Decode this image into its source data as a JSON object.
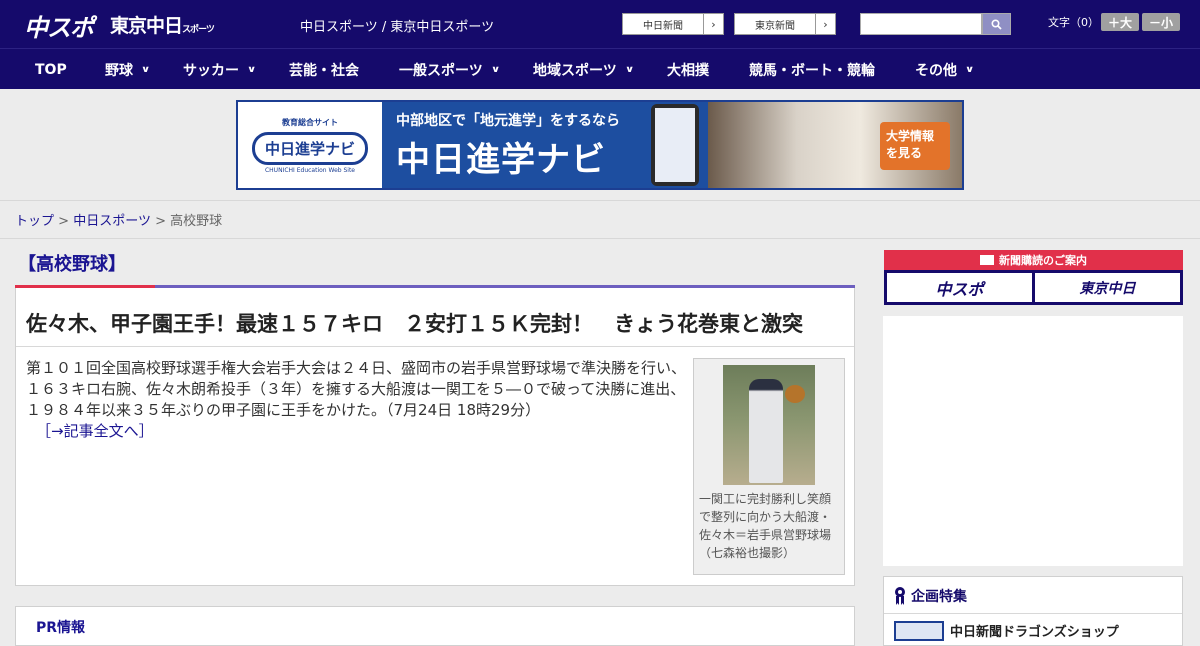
{
  "header": {
    "logo_chusupo": "中スポ",
    "logo_tokyo": "東京中日",
    "logo_tokyo_small": "スポーツ",
    "tagline": "中日スポーツ / 東京中日スポーツ",
    "paper_links": [
      {
        "label": "中日新聞"
      },
      {
        "label": "東京新聞"
      }
    ],
    "search_placeholder": "",
    "font_size_label": "文字（0）",
    "font_bigger": "＋大",
    "font_smaller": "－小"
  },
  "nav": {
    "items": [
      {
        "label": "TOP",
        "has_menu": false
      },
      {
        "label": "野球",
        "has_menu": true
      },
      {
        "label": "サッカー",
        "has_menu": true
      },
      {
        "label": "芸能・社会",
        "has_menu": false
      },
      {
        "label": "一般スポーツ",
        "has_menu": true
      },
      {
        "label": "地域スポーツ",
        "has_menu": true
      },
      {
        "label": "大相撲",
        "has_menu": false
      },
      {
        "label": "競馬・ボート・競輪",
        "has_menu": false
      },
      {
        "label": "その他",
        "has_menu": true
      }
    ]
  },
  "banner": {
    "logo_small": "教育総合サイト",
    "logo_big": "中日進学ナビ",
    "logo_en": "CHUNICHI Education Web Site",
    "line1": "中部地区で「地元進学」をするなら",
    "line2": "中日進学ナビ",
    "cta": "大学情報を見る"
  },
  "breadcrumb": {
    "items": [
      "トップ",
      "中日スポーツ",
      "高校野球"
    ],
    "separator": ">"
  },
  "category": {
    "heading": "【高校野球】"
  },
  "article": {
    "headline": "佐々木、甲子園王手！最速１５７キロ　２安打１５Ｋ完封！　きょう花巻東と激突",
    "body": "第１０１回全国高校野球選手権大会岩手大会は２４日、盛岡市の岩手県営野球場で準決勝を行い、１６３キロ右腕、佐々木朗希投手（３年）を擁する大船渡は一関工を５―０で破って決勝に進出、１９８４年以来３５年ぶりの甲子園に王手をかけた。（7月24日 18時29分）",
    "more_link": "［→記事全文へ］",
    "photo_caption": "一関工に完封勝利し笑顔で整列に向かう大船渡・佐々木＝岩手県営野球場（七森裕也撮影）"
  },
  "pr": {
    "title": "PR情報"
  },
  "sidebar": {
    "subscribe_head": "新聞購読のご案内",
    "subscribe_buttons": [
      "中スポ",
      "東京中日"
    ],
    "feature_head": "企画特集",
    "feature_item": "中日新聞ドラゴンズショップ"
  },
  "colors": {
    "brand_navy": "#150a6b",
    "accent_red": "#e1304a",
    "link_blue": "#1b1592"
  }
}
